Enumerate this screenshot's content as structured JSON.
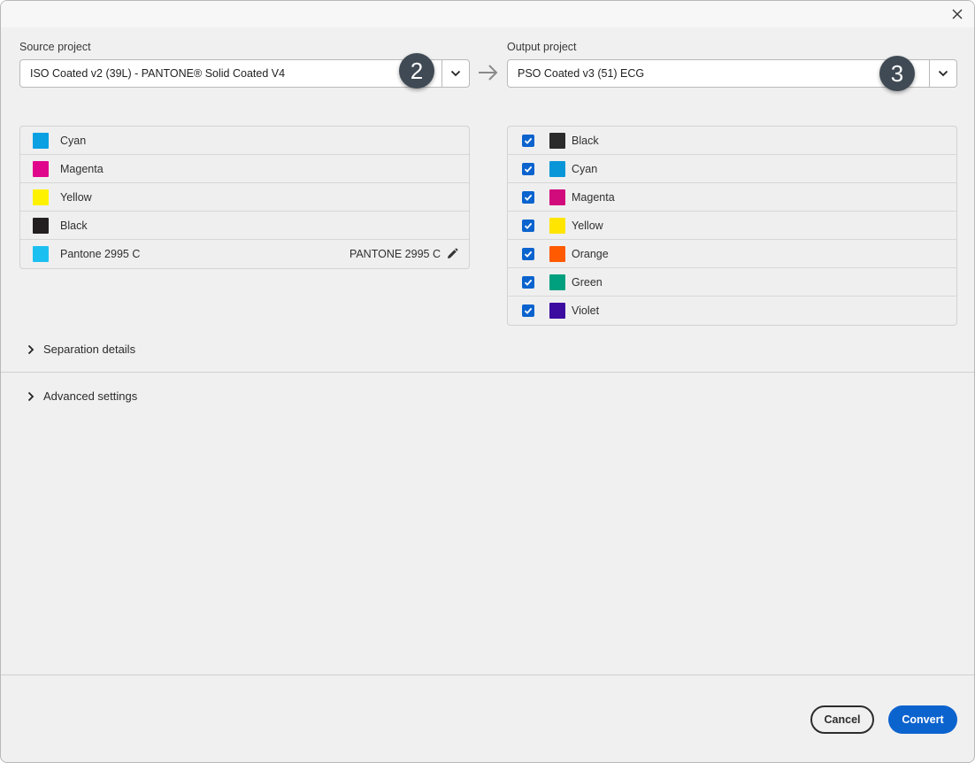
{
  "dialog": {
    "source": {
      "label": "Source project",
      "value": "ISO Coated v2 (39L) - PANTONE® Solid Coated V4"
    },
    "output": {
      "label": "Output project",
      "value": "PSO Coated v3 (51) ECG"
    },
    "badges": {
      "source": "2",
      "output": "3"
    },
    "source_inks": [
      {
        "name": "Cyan",
        "color": "#0aa0e2"
      },
      {
        "name": "Magenta",
        "color": "#e0068c"
      },
      {
        "name": "Yellow",
        "color": "#fff200"
      },
      {
        "name": "Black",
        "color": "#231f20"
      },
      {
        "name": "Pantone 2995 C",
        "color": "#1cc0f0",
        "mapped_to": "PANTONE 2995 C"
      }
    ],
    "output_inks": [
      {
        "name": "Black",
        "color": "#2b2b2b",
        "checked": true
      },
      {
        "name": "Cyan",
        "color": "#0896d9",
        "checked": true
      },
      {
        "name": "Magenta",
        "color": "#d20b7c",
        "checked": true
      },
      {
        "name": "Yellow",
        "color": "#ffe500",
        "checked": true
      },
      {
        "name": "Orange",
        "color": "#ff5a00",
        "checked": true
      },
      {
        "name": "Green",
        "color": "#00a07e",
        "checked": true
      },
      {
        "name": "Violet",
        "color": "#3c0ba0",
        "checked": true
      }
    ],
    "sections": {
      "separation": "Separation details",
      "advanced": "Advanced settings"
    },
    "buttons": {
      "cancel": "Cancel",
      "convert": "Convert"
    }
  }
}
